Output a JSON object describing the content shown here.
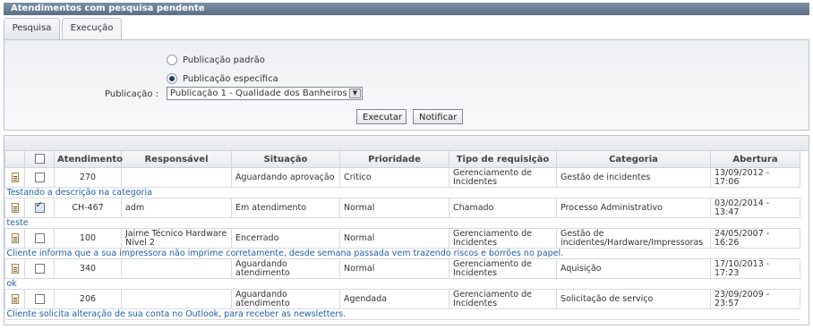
{
  "window": {
    "title": "Atendimentos com pesquisa pendente"
  },
  "tabs": [
    {
      "label": "Pesquisa"
    },
    {
      "label": "Execução"
    }
  ],
  "form": {
    "radio_default_label": "Publicação padrão",
    "radio_specific_label": "Publicação específica",
    "selected_radio": "specific",
    "publication_label": "Publicação :",
    "publication_value": "Publicação 1 - Qualidade dos Banheiros",
    "execute_label": "Executar",
    "notify_label": "Notificar"
  },
  "table": {
    "headers": [
      "Atendimento",
      "Responsável",
      "Situação",
      "Prioridade",
      "Tipo de requisição",
      "Categoria",
      "Abertura"
    ],
    "rows": [
      {
        "atendimento": "270",
        "responsavel": "",
        "situacao": "Aguardando aprovação",
        "prioridade": "Critico",
        "tipo": "Gerenciamento de Incidentes",
        "categoria": "Gestão de incidentes",
        "abertura": "13/09/2012 - 17:06",
        "checked": false,
        "descricao": "Testando a descrição na categoria"
      },
      {
        "atendimento": "CH-467",
        "responsavel": "adm",
        "situacao": "Em atendimento",
        "prioridade": "Normal",
        "tipo": "Chamado",
        "categoria": "Processo Administrativo",
        "abertura": "03/02/2014 - 13:47",
        "checked": true,
        "descricao": "teste"
      },
      {
        "atendimento": "100",
        "responsavel": "Jaime Técnico Hardware Nível 2",
        "situacao": "Encerrado",
        "prioridade": "Normal",
        "tipo": "Gerenciamento de Incidentes",
        "categoria": "Gestão de incidentes/Hardware/Impressoras",
        "abertura": "24/05/2007 - 16:26",
        "checked": false,
        "descricao": "Cliente  informa que a sua impressora não imprime corretamente, desde semana passada vem trazendo riscos e borrões no papel."
      },
      {
        "atendimento": "340",
        "responsavel": "",
        "situacao": "Aguardando atendimento",
        "prioridade": "Normal",
        "tipo": "Gerenciamento de Incidentes",
        "categoria": "Aquisição",
        "abertura": "17/10/2013 - 17:23",
        "checked": false,
        "descricao": "ok"
      },
      {
        "atendimento": "206",
        "responsavel": "",
        "situacao": "Aguardando atendimento",
        "prioridade": "Agendada",
        "tipo": "Gerenciamento de Incidentes",
        "categoria": "Solicitação de serviço",
        "abertura": "23/09/2009 - 23:57",
        "checked": false,
        "descricao": "Cliente solicita alteração de sua conta no Outlook, para receber as newsletters."
      }
    ]
  }
}
